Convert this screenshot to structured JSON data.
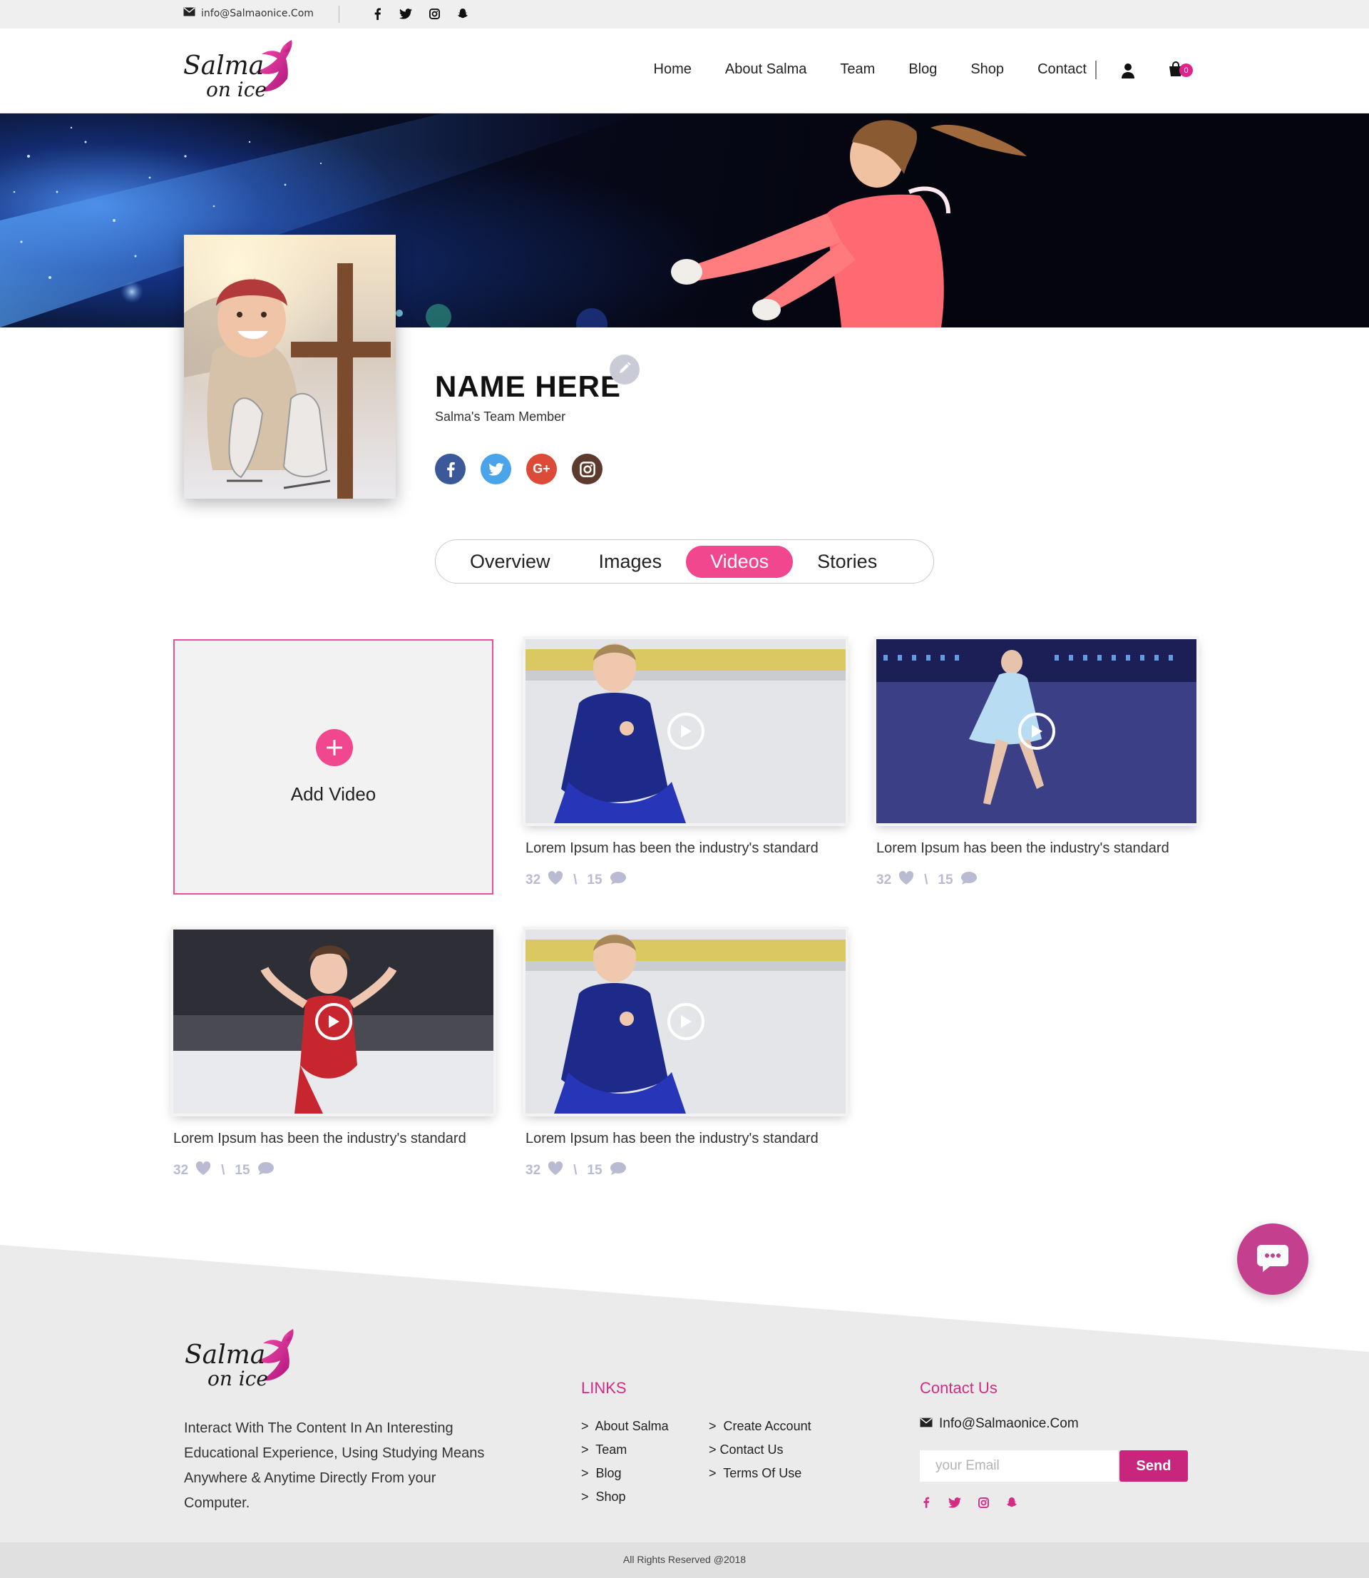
{
  "topbar": {
    "email": "info@Salmaonice.Com",
    "social_icons": [
      "facebook-icon",
      "twitter-icon",
      "instagram-icon",
      "snapchat-icon"
    ]
  },
  "brand": {
    "logo_line1": "Salma",
    "logo_line2": "on ice",
    "accent_color": "#e0238a"
  },
  "nav": {
    "items": [
      "Home",
      "About Salma",
      "Team",
      "Blog",
      "Shop",
      "Contact"
    ],
    "cart_count": "0"
  },
  "profile": {
    "name": "NAME HERE",
    "role": "Salma's Team Member",
    "social_icons": [
      "facebook-icon",
      "twitter-icon",
      "google-plus-icon",
      "instagram-icon"
    ],
    "google_plus_label": "G+"
  },
  "tabs": {
    "items": [
      "Overview",
      "Images",
      "Videos",
      "Stories"
    ],
    "active": "Videos"
  },
  "videos": {
    "add_label": "Add Video",
    "items": [
      {
        "title": "Lorem Ipsum has been the industry's standard",
        "likes": "32",
        "separator": "\\",
        "comments": "15"
      },
      {
        "title": "Lorem Ipsum has been the industry's standard",
        "likes": "32",
        "separator": "\\",
        "comments": "15"
      },
      {
        "title": "Lorem Ipsum has been the industry's standard",
        "likes": "32",
        "separator": "\\",
        "comments": "15"
      },
      {
        "title": "Lorem Ipsum has been the industry's standard",
        "likes": "32",
        "separator": "\\",
        "comments": "15"
      }
    ]
  },
  "footer": {
    "description": "Interact With The Content In An Interesting Educational Experience, Using Studying Means Anywhere & Anytime Directly From your Computer.",
    "links_heading": "LINKS",
    "links_col1": [
      "About Salma",
      "Team",
      "Blog",
      "Shop"
    ],
    "links_col2": [
      "Create Account",
      "Contact Us",
      "Terms Of Use"
    ],
    "contact_heading": "Contact Us",
    "contact_email": "Info@Salmaonice.Com",
    "email_placeholder": "your Email",
    "send_label": "Send",
    "copyright": "All Rights Reserved @2018"
  }
}
